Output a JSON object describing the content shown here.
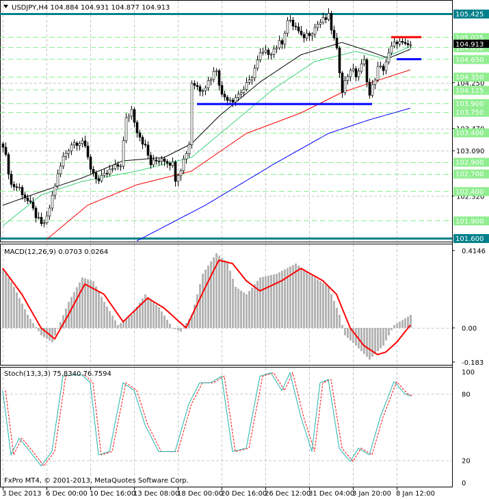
{
  "header": {
    "symbol": "USDJPY,H4",
    "ohlc": "104.884 104.931 104.877 104.913"
  },
  "macd_header": "MACD(12,26,9) 0.0703 0.0264",
  "stoch_header": "Stoch(13,3,3) 75.8340 76.7594",
  "copyright": "FxPro MT4, © 2001-2013, MetaQuotes Software Corp.",
  "colors": {
    "level": "#90ee90",
    "teal": "#00808a",
    "red": "#ff0000",
    "blue": "#0000ff",
    "green_ma": "#3cd27a",
    "black_ma": "#000000",
    "hist": "#b4b4b4",
    "stoch": "#20b2aa"
  },
  "chart_data": [
    {
      "type": "candlestick",
      "title": "USDJPY,H4",
      "ylim": [
        101.6,
        105.425
      ],
      "bars": 150,
      "x_tick_labels": [
        {
          "bar": 0,
          "label": "3 Dec 2013"
        },
        {
          "bar": 16,
          "label": "6 Dec 00:00"
        },
        {
          "bar": 32,
          "label": "10 Dec 16:00"
        },
        {
          "bar": 48,
          "label": "13 Dec 08:00"
        },
        {
          "bar": 64,
          "label": "18 Dec 00:00"
        },
        {
          "bar": 80,
          "label": "20 Dec 16:00"
        },
        {
          "bar": 96,
          "label": "26 Dec 12:00"
        },
        {
          "bar": 112,
          "label": "31 Dec 04:00"
        },
        {
          "bar": 128,
          "label": "3 Jan 20:00"
        },
        {
          "bar": 144,
          "label": "8 Jan 12:00"
        }
      ],
      "y_tick_labels": [
        "104.250",
        "103.470",
        "103.090",
        "102.320"
      ],
      "levels": [
        {
          "value": 105.425,
          "label": "105.425",
          "style": "teal"
        },
        {
          "value": 105.025,
          "label": "105.025",
          "style": "green"
        },
        {
          "value": 104.85,
          "label": "104.850",
          "style": "green"
        },
        {
          "value": 104.65,
          "label": "104.650",
          "style": "green"
        },
        {
          "value": 104.35,
          "label": "104.350",
          "style": "green"
        },
        {
          "value": 104.125,
          "label": "104.125",
          "style": "green"
        },
        {
          "value": 103.9,
          "label": "103.900",
          "style": "green"
        },
        {
          "value": 103.75,
          "label": "103.750",
          "style": "green"
        },
        {
          "value": 103.4,
          "label": "103.400",
          "style": "green"
        },
        {
          "value": 102.9,
          "label": "102.900",
          "style": "green"
        },
        {
          "value": 102.7,
          "label": "102.700",
          "style": "green"
        },
        {
          "value": 102.4,
          "label": "102.400",
          "style": "green"
        },
        {
          "value": 101.9,
          "label": "101.900",
          "style": "green"
        },
        {
          "value": 101.6,
          "label": "101.600",
          "style": "teal"
        }
      ],
      "current_price": {
        "value": 104.913,
        "label": "104.913"
      },
      "close_path": [
        [
          0,
          103.209
        ],
        [
          3,
          102.51
        ],
        [
          6,
          102.451
        ],
        [
          10,
          102.16
        ],
        [
          14,
          101.81
        ],
        [
          16,
          101.927
        ],
        [
          19,
          102.51
        ],
        [
          22,
          102.976
        ],
        [
          25,
          103.209
        ],
        [
          29,
          103.268
        ],
        [
          32,
          102.801
        ],
        [
          35,
          102.568
        ],
        [
          39,
          102.743
        ],
        [
          43,
          102.86
        ],
        [
          45,
          103.617
        ],
        [
          47,
          103.792
        ],
        [
          49,
          103.442
        ],
        [
          52,
          103.151
        ],
        [
          54,
          102.86
        ],
        [
          58,
          102.976
        ],
        [
          62,
          102.86
        ],
        [
          63,
          102.626
        ],
        [
          65,
          102.801
        ],
        [
          68,
          103.209
        ],
        [
          69,
          104.259
        ],
        [
          72,
          104.142
        ],
        [
          74,
          104.2
        ],
        [
          78,
          104.492
        ],
        [
          80,
          104.026
        ],
        [
          84,
          103.967
        ],
        [
          88,
          104.142
        ],
        [
          90,
          104.259
        ],
        [
          94,
          104.725
        ],
        [
          98,
          104.784
        ],
        [
          102,
          104.959
        ],
        [
          104,
          105.308
        ],
        [
          107,
          105.192
        ],
        [
          109,
          105.017
        ],
        [
          113,
          105.133
        ],
        [
          115,
          105.25
        ],
        [
          119,
          105.367
        ],
        [
          122,
          104.784
        ],
        [
          124,
          104.142
        ],
        [
          127,
          104.492
        ],
        [
          129,
          104.375
        ],
        [
          132,
          104.609
        ],
        [
          134,
          104.026
        ],
        [
          137,
          104.492
        ],
        [
          139,
          104.492
        ],
        [
          142,
          104.842
        ],
        [
          144,
          104.959
        ],
        [
          147,
          104.865
        ],
        [
          149,
          104.9
        ]
      ],
      "ma_black": [
        [
          0,
          102.16
        ],
        [
          14,
          102.393
        ],
        [
          29,
          102.626
        ],
        [
          44,
          102.918
        ],
        [
          59,
          102.976
        ],
        [
          69,
          103.209
        ],
        [
          79,
          103.676
        ],
        [
          94,
          104.259
        ],
        [
          109,
          104.725
        ],
        [
          124,
          104.935
        ],
        [
          134,
          104.784
        ],
        [
          141,
          104.667
        ],
        [
          149,
          104.819
        ]
      ],
      "ma_green": [
        [
          0,
          101.81
        ],
        [
          14,
          102.335
        ],
        [
          29,
          102.568
        ],
        [
          49,
          102.743
        ],
        [
          69,
          102.976
        ],
        [
          84,
          103.559
        ],
        [
          99,
          104.142
        ],
        [
          114,
          104.609
        ],
        [
          129,
          104.784
        ],
        [
          139,
          104.667
        ],
        [
          149,
          104.865
        ]
      ],
      "ma_red": [
        [
          16,
          101.577
        ],
        [
          31,
          102.16
        ],
        [
          49,
          102.51
        ],
        [
          69,
          102.743
        ],
        [
          89,
          103.384
        ],
        [
          109,
          103.734
        ],
        [
          124,
          104.084
        ],
        [
          139,
          104.317
        ],
        [
          149,
          104.469
        ]
      ],
      "ma_blue": [
        [
          49,
          101.553
        ],
        [
          74,
          102.16
        ],
        [
          99,
          102.86
        ],
        [
          119,
          103.384
        ],
        [
          134,
          103.617
        ],
        [
          149,
          103.816
        ]
      ],
      "trendlines": [
        {
          "color": "blue",
          "value": 103.885,
          "from_bar": 71,
          "to_bar": 135
        },
        {
          "color": "red",
          "value": 105.025,
          "from_bar": 142,
          "to_bar": 153
        },
        {
          "color": "blue",
          "value": 104.65,
          "from_bar": 144,
          "to_bar": 153
        }
      ]
    },
    {
      "type": "bar+line",
      "title": "MACD(12,26,9)",
      "ylim": [
        -0.183,
        0.4146
      ],
      "y_tick_labels": [
        "0.4146",
        "0.00",
        "-0.183"
      ],
      "histogram": [
        [
          0,
          0.32
        ],
        [
          4,
          0.22
        ],
        [
          9,
          0.07
        ],
        [
          14,
          -0.04
        ],
        [
          18,
          -0.077
        ],
        [
          24,
          0.14
        ],
        [
          29,
          0.27
        ],
        [
          33,
          0.25
        ],
        [
          37,
          0.14
        ],
        [
          42,
          0.015
        ],
        [
          47,
          0.07
        ],
        [
          52,
          0.18
        ],
        [
          57,
          0.11
        ],
        [
          62,
          0
        ],
        [
          65,
          -0.02
        ],
        [
          69,
          0.07
        ],
        [
          73,
          0.29
        ],
        [
          78,
          0.4
        ],
        [
          82,
          0.35
        ],
        [
          85,
          0.22
        ],
        [
          89,
          0.18
        ],
        [
          94,
          0.27
        ],
        [
          100,
          0.29
        ],
        [
          107,
          0.345
        ],
        [
          112,
          0.29
        ],
        [
          119,
          0.22
        ],
        [
          123,
          0.07
        ],
        [
          125,
          -0.04
        ],
        [
          129,
          -0.095
        ],
        [
          134,
          -0.17
        ],
        [
          139,
          -0.095
        ],
        [
          143,
          0.015
        ],
        [
          149,
          0.07
        ]
      ],
      "signal": [
        [
          0,
          0.32
        ],
        [
          7,
          0.18
        ],
        [
          14,
          0
        ],
        [
          19,
          -0.059
        ],
        [
          24,
          0.07
        ],
        [
          30,
          0.235
        ],
        [
          37,
          0.18
        ],
        [
          44,
          0.033
        ],
        [
          53,
          0.16
        ],
        [
          59,
          0.106
        ],
        [
          67,
          0
        ],
        [
          74,
          0.216
        ],
        [
          79,
          0.363
        ],
        [
          84,
          0.345
        ],
        [
          89,
          0.253
        ],
        [
          94,
          0.198
        ],
        [
          102,
          0.253
        ],
        [
          109,
          0.319
        ],
        [
          117,
          0.253
        ],
        [
          122,
          0.18
        ],
        [
          127,
          0
        ],
        [
          132,
          -0.095
        ],
        [
          137,
          -0.143
        ],
        [
          140,
          -0.13
        ],
        [
          144,
          -0.077
        ],
        [
          149,
          0.015
        ]
      ]
    },
    {
      "type": "line",
      "title": "Stoch(13,3,3)",
      "ylim": [
        0,
        100
      ],
      "y_tick_labels": [
        "100",
        "80",
        "20",
        "0"
      ],
      "main": [
        [
          0,
          83
        ],
        [
          3,
          25
        ],
        [
          6,
          40
        ],
        [
          10,
          28
        ],
        [
          14,
          15
        ],
        [
          18,
          28
        ],
        [
          22,
          96
        ],
        [
          25,
          97
        ],
        [
          29,
          97
        ],
        [
          32,
          90
        ],
        [
          35,
          25
        ],
        [
          39,
          28
        ],
        [
          44,
          90
        ],
        [
          48,
          83
        ],
        [
          52,
          52
        ],
        [
          57,
          28
        ],
        [
          63,
          28
        ],
        [
          68,
          71
        ],
        [
          72,
          90
        ],
        [
          76,
          90
        ],
        [
          80,
          96
        ],
        [
          84,
          28
        ],
        [
          89,
          31
        ],
        [
          94,
          96
        ],
        [
          98,
          99
        ],
        [
          102,
          83
        ],
        [
          105,
          99
        ],
        [
          109,
          59
        ],
        [
          113,
          28
        ],
        [
          116,
          90
        ],
        [
          119,
          93
        ],
        [
          123,
          31
        ],
        [
          127,
          19
        ],
        [
          130,
          31
        ],
        [
          134,
          25
        ],
        [
          138,
          59
        ],
        [
          143,
          91
        ],
        [
          147,
          80
        ],
        [
          149,
          78
        ]
      ]
    }
  ]
}
